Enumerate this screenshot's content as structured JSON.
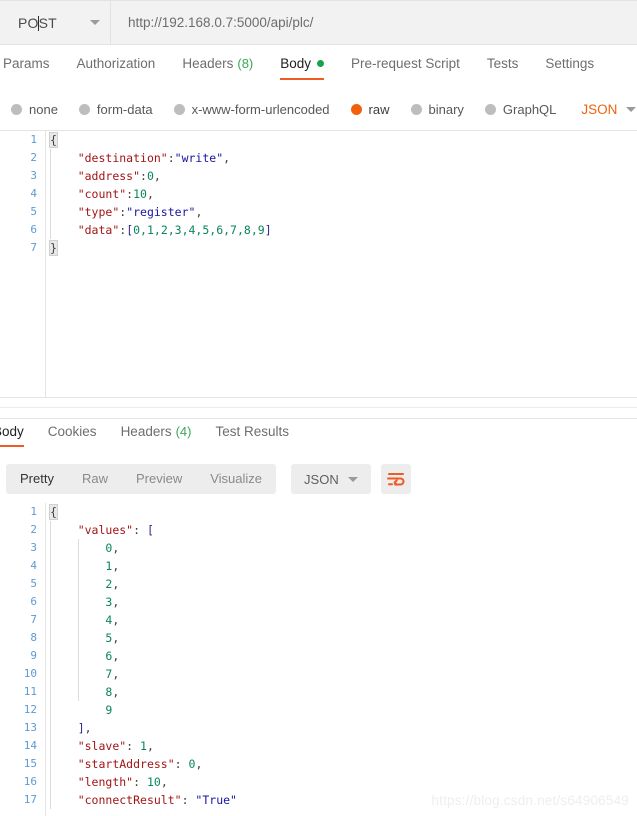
{
  "request_bar": {
    "method": "POST",
    "method_caret_after": 2,
    "url": "http://192.168.0.7:5000/api/plc/",
    "dropdown_icon": "chevron-down-icon"
  },
  "request_tabs": [
    {
      "label": "Params",
      "active": false
    },
    {
      "label": "Authorization",
      "active": false
    },
    {
      "label": "Headers",
      "count": "(8)",
      "active": false
    },
    {
      "label": "Body",
      "active": true,
      "dot": true
    },
    {
      "label": "Pre-request Script",
      "active": false
    },
    {
      "label": "Tests",
      "active": false
    },
    {
      "label": "Settings",
      "active": false
    }
  ],
  "body_types": {
    "options": [
      {
        "label": "none",
        "checked": false
      },
      {
        "label": "form-data",
        "checked": false
      },
      {
        "label": "x-www-form-urlencoded",
        "checked": false
      },
      {
        "label": "raw",
        "checked": true
      },
      {
        "label": "binary",
        "checked": false
      },
      {
        "label": "GraphQL",
        "checked": false
      }
    ],
    "format": "JSON",
    "format_caret_icon": "chevron-down-icon"
  },
  "request_body": {
    "line_numbers": [
      "1",
      "2",
      "3",
      "4",
      "5",
      "6",
      "7"
    ],
    "lines": [
      [
        {
          "t": "{",
          "c": "brace"
        }
      ],
      [
        {
          "t": "    ",
          "c": "p"
        },
        {
          "t": "\"destination\"",
          "c": "k"
        },
        {
          "t": ":",
          "c": "p"
        },
        {
          "t": "\"write\"",
          "c": "s"
        },
        {
          "t": ",",
          "c": "p"
        }
      ],
      [
        {
          "t": "    ",
          "c": "p"
        },
        {
          "t": "\"address\"",
          "c": "k"
        },
        {
          "t": ":",
          "c": "p"
        },
        {
          "t": "0",
          "c": "n"
        },
        {
          "t": ",",
          "c": "p"
        }
      ],
      [
        {
          "t": "    ",
          "c": "p"
        },
        {
          "t": "\"count\"",
          "c": "k"
        },
        {
          "t": ":",
          "c": "p"
        },
        {
          "t": "10",
          "c": "n"
        },
        {
          "t": ",",
          "c": "p"
        }
      ],
      [
        {
          "t": "    ",
          "c": "p"
        },
        {
          "t": "\"type\"",
          "c": "k"
        },
        {
          "t": ":",
          "c": "p"
        },
        {
          "t": "\"register\"",
          "c": "s"
        },
        {
          "t": ",",
          "c": "p"
        }
      ],
      [
        {
          "t": "    ",
          "c": "p"
        },
        {
          "t": "\"data\"",
          "c": "k"
        },
        {
          "t": ":",
          "c": "p"
        },
        {
          "t": "[",
          "c": "br"
        },
        {
          "t": "0,1,2,3,4,5,6,7,8,9",
          "c": "n"
        },
        {
          "t": "]",
          "c": "br"
        }
      ],
      [
        {
          "t": "}",
          "c": "brace"
        }
      ]
    ]
  },
  "response_tabs": [
    {
      "label": "Body",
      "active": true
    },
    {
      "label": "Cookies",
      "active": false
    },
    {
      "label": "Headers",
      "count": "(4)",
      "active": false
    },
    {
      "label": "Test Results",
      "active": false
    }
  ],
  "response_toolbar": {
    "view_modes": [
      {
        "label": "Pretty",
        "active": true
      },
      {
        "label": "Raw",
        "active": false
      },
      {
        "label": "Preview",
        "active": false
      },
      {
        "label": "Visualize",
        "active": false
      }
    ],
    "format": "JSON",
    "format_caret_icon": "chevron-down-icon",
    "wrap_icon": "word-wrap-icon"
  },
  "response_body": {
    "line_numbers": [
      "1",
      "2",
      "3",
      "4",
      "5",
      "6",
      "7",
      "8",
      "9",
      "10",
      "11",
      "12",
      "13",
      "14",
      "15",
      "16",
      "17"
    ],
    "lines": [
      [
        {
          "t": "{",
          "c": "brace"
        }
      ],
      [
        {
          "t": "    ",
          "c": "p"
        },
        {
          "t": "\"values\"",
          "c": "k"
        },
        {
          "t": ": ",
          "c": "p"
        },
        {
          "t": "[",
          "c": "br"
        }
      ],
      [
        {
          "t": "        ",
          "c": "p"
        },
        {
          "t": "0",
          "c": "n"
        },
        {
          "t": ",",
          "c": "p"
        }
      ],
      [
        {
          "t": "        ",
          "c": "p"
        },
        {
          "t": "1",
          "c": "n"
        },
        {
          "t": ",",
          "c": "p"
        }
      ],
      [
        {
          "t": "        ",
          "c": "p"
        },
        {
          "t": "2",
          "c": "n"
        },
        {
          "t": ",",
          "c": "p"
        }
      ],
      [
        {
          "t": "        ",
          "c": "p"
        },
        {
          "t": "3",
          "c": "n"
        },
        {
          "t": ",",
          "c": "p"
        }
      ],
      [
        {
          "t": "        ",
          "c": "p"
        },
        {
          "t": "4",
          "c": "n"
        },
        {
          "t": ",",
          "c": "p"
        }
      ],
      [
        {
          "t": "        ",
          "c": "p"
        },
        {
          "t": "5",
          "c": "n"
        },
        {
          "t": ",",
          "c": "p"
        }
      ],
      [
        {
          "t": "        ",
          "c": "p"
        },
        {
          "t": "6",
          "c": "n"
        },
        {
          "t": ",",
          "c": "p"
        }
      ],
      [
        {
          "t": "        ",
          "c": "p"
        },
        {
          "t": "7",
          "c": "n"
        },
        {
          "t": ",",
          "c": "p"
        }
      ],
      [
        {
          "t": "        ",
          "c": "p"
        },
        {
          "t": "8",
          "c": "n"
        },
        {
          "t": ",",
          "c": "p"
        }
      ],
      [
        {
          "t": "        ",
          "c": "p"
        },
        {
          "t": "9",
          "c": "n"
        }
      ],
      [
        {
          "t": "    ",
          "c": "p"
        },
        {
          "t": "]",
          "c": "br"
        },
        {
          "t": ",",
          "c": "p"
        }
      ],
      [
        {
          "t": "    ",
          "c": "p"
        },
        {
          "t": "\"slave\"",
          "c": "k"
        },
        {
          "t": ": ",
          "c": "p"
        },
        {
          "t": "1",
          "c": "n"
        },
        {
          "t": ",",
          "c": "p"
        }
      ],
      [
        {
          "t": "    ",
          "c": "p"
        },
        {
          "t": "\"startAddress\"",
          "c": "k"
        },
        {
          "t": ": ",
          "c": "p"
        },
        {
          "t": "0",
          "c": "n"
        },
        {
          "t": ",",
          "c": "p"
        }
      ],
      [
        {
          "t": "    ",
          "c": "p"
        },
        {
          "t": "\"length\"",
          "c": "k"
        },
        {
          "t": ": ",
          "c": "p"
        },
        {
          "t": "10",
          "c": "n"
        },
        {
          "t": ",",
          "c": "p"
        }
      ],
      [
        {
          "t": "    ",
          "c": "p"
        },
        {
          "t": "\"connectResult\"",
          "c": "k"
        },
        {
          "t": ": ",
          "c": "p"
        },
        {
          "t": "\"True\"",
          "c": "s"
        }
      ]
    ]
  },
  "watermark": "https://blog.csdn.net/s64906549",
  "colors": {
    "accent": "#ef5b25",
    "raw_radio": "#f2600c",
    "json_label": "#f2600c",
    "body_dot": "#16a34a",
    "header_count": "#3aa757",
    "json_key": "#a31515",
    "json_string": "#1515a3",
    "json_number": "#098658",
    "line_number": "#5b9bd5"
  }
}
